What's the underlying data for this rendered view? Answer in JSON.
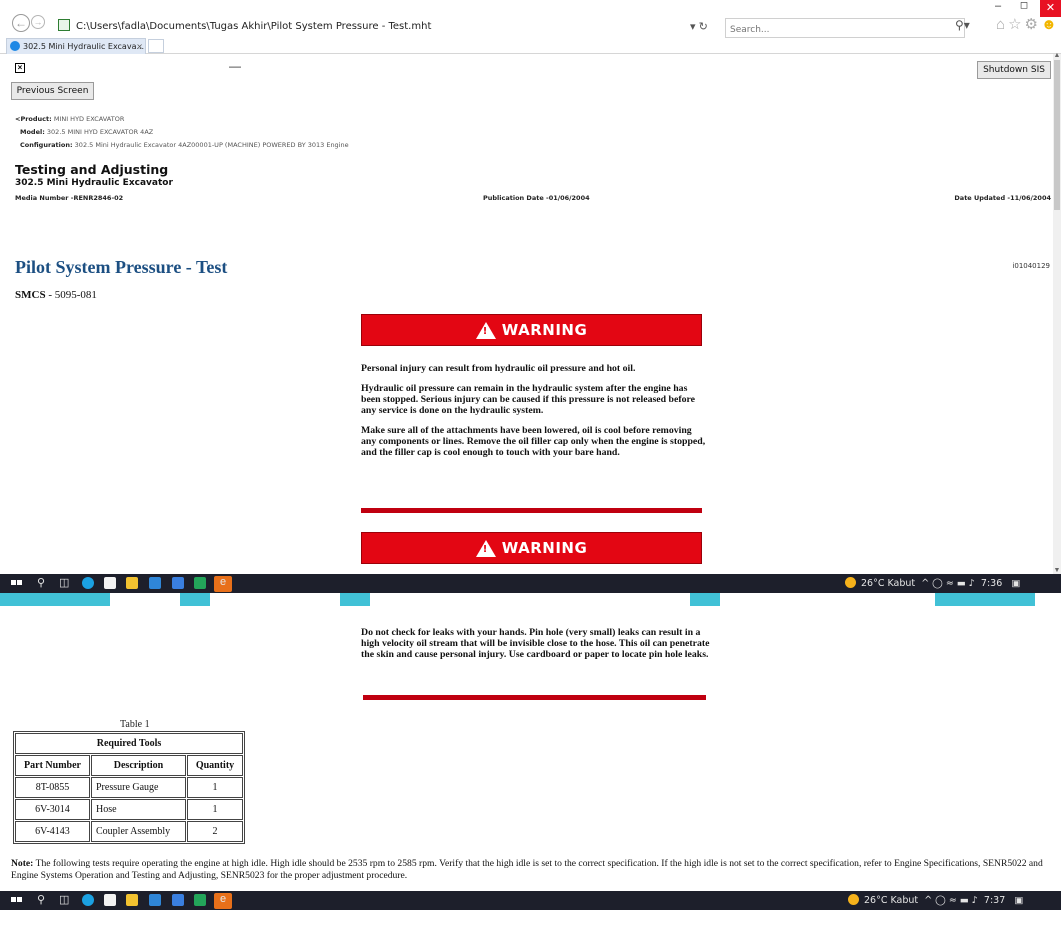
{
  "browser": {
    "address": "C:\\Users\\fadla\\Documents\\Tugas Akhir\\Pilot System Pressure - Test.mht",
    "search_placeholder": "Search...",
    "tab_title": "302.5 Mini Hydraulic Excava..."
  },
  "sis": {
    "previous_button": "Previous Screen",
    "shutdown_button": "Shutdown SIS",
    "product_label": "<Product:",
    "product_value": "MINI HYD EXCAVATOR",
    "model_label": "Model:",
    "model_value": "302.5 MINI HYD EXCAVATOR 4AZ",
    "config_label": "Configuration:",
    "config_value": "302.5 Mini Hydraulic Excavator 4AZ00001-UP (MACHINE) POWERED BY 3013 Engine",
    "section": "Testing and Adjusting",
    "machine": "302.5 Mini Hydraulic Excavator",
    "media_number": "Media Number -RENR2846-02",
    "publication_date": "Publication Date -01/06/2004",
    "date_updated": "Date Updated -11/06/2004",
    "doc_id": "i01040129",
    "title": "Pilot System Pressure - Test",
    "smcs_label": "SMCS",
    "smcs_value": " - 5095-081"
  },
  "warnings": {
    "label": "WARNING",
    "first": [
      "Personal injury can result from hydraulic oil pressure and hot oil.",
      "Hydraulic oil pressure can remain in the hydraulic system after the engine has been stopped. Serious injury can be caused if this pressure is not released before any service is done on the hydraulic system.",
      "Make sure all of the attachments have been lowered, oil is cool before removing any components or lines. Remove the oil filler cap only when the engine is stopped, and the filler cap is cool enough to touch with your bare hand."
    ],
    "second": [
      "Do not check for leaks with your hands. Pin hole (very small) leaks can result in a high velocity oil stream that will be invisible close to the hose. This oil can penetrate the skin and cause personal injury. Use cardboard or paper to locate pin hole leaks."
    ]
  },
  "tools_table": {
    "caption": "Table 1",
    "heading": "Required Tools",
    "columns": [
      "Part Number",
      "Description",
      "Quantity"
    ],
    "rows": [
      [
        "8T-0855",
        "Pressure Gauge",
        "1"
      ],
      [
        "6V-3014",
        "Hose",
        "1"
      ],
      [
        "6V-4143",
        "Coupler Assembly",
        "2"
      ]
    ]
  },
  "note": {
    "label": "Note:",
    "text": " The following tests require operating the engine at high idle. High idle should be 2535 rpm to 2585 rpm. Verify that the high idle is set to the correct specification. If the high idle is not set to the correct specification, refer to Engine Specifications, SENR5022 and Engine Systems Operation and Testing and Adjusting, SENR5023 for the proper adjustment procedure."
  },
  "taskbar_top": {
    "weather": "26°C Kabut",
    "clock": "7:36"
  },
  "taskbar_bottom": {
    "weather": "26°C Kabut",
    "clock": "7:37"
  },
  "colors": {
    "warning_red": "#e30613",
    "title_blue": "#1c4f82",
    "taskbar": "#1d1f2b",
    "watermark": "#20b6cf"
  }
}
